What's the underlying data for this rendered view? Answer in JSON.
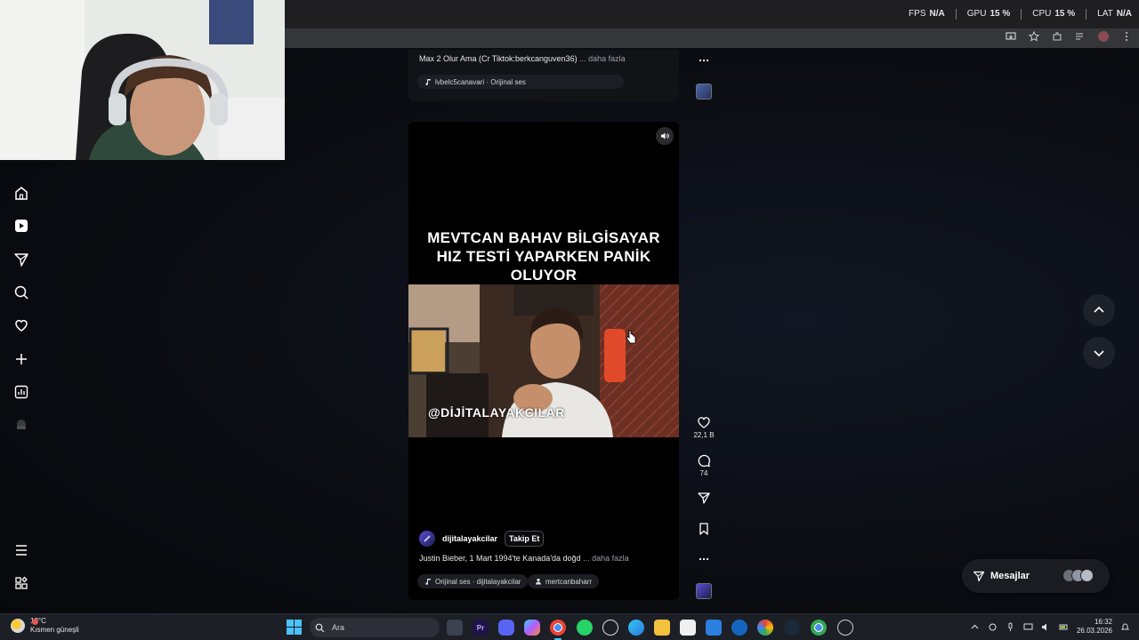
{
  "overlay": {
    "fps_label": "FPS",
    "fps_value": "N/A",
    "gpu_label": "GPU",
    "gpu_value": "15 %",
    "cpu_label": "CPU",
    "cpu_value": "15 %",
    "lat_label": "LAT",
    "lat_value": "N/A"
  },
  "browser": {
    "toolbar_icons": [
      "install-icon",
      "star-icon",
      "extensions-icon",
      "media-icon",
      "profile-icon",
      "menu-icon"
    ]
  },
  "left_nav": {
    "items": [
      {
        "name": "home-icon"
      },
      {
        "name": "reels-icon"
      },
      {
        "name": "send-icon"
      },
      {
        "name": "search-icon"
      },
      {
        "name": "heart-icon"
      },
      {
        "name": "plus-icon"
      },
      {
        "name": "dashboard-icon"
      },
      {
        "name": "avatar-icon"
      },
      {
        "name": "menu-icon"
      },
      {
        "name": "apps-icon"
      }
    ]
  },
  "previous_post": {
    "caption": "Max 2 Olur Ama (Cr Tiktok:berkcanguven36)",
    "more": "... daha fazla",
    "audio": "lvbelc5canavari · Orijinal ses"
  },
  "post": {
    "headline_lines": [
      "MEVTCAN BAHAV BİLGİSAYAR",
      "HIZ TESTİ YAPARKEN PANİK",
      "OLUYOR"
    ],
    "watermark": "@DİJİTALAYAKCILAR",
    "author": "dijitalayakcilar",
    "follow_label": "Takip Et",
    "caption": "Justin Bieber, 1 Mart 1994'te Kanada'da doğd",
    "more": "... daha fazla",
    "audio": "Orijinal ses · dijitalayakcilar",
    "tagged_user": "mertcanbaharr",
    "likes": "22,1 B",
    "comments": "74"
  },
  "messages": {
    "label": "Mesajlar"
  },
  "taskbar": {
    "temperature": "13°C",
    "weather": "Kısmen güneşli",
    "search_placeholder": "Ara",
    "time": "16:32",
    "date": "26.03.2026",
    "apps": [
      "file-explorer",
      "premiere-pro",
      "discord",
      "copilot",
      "chrome",
      "whatsapp",
      "chatgpt",
      "edge",
      "folder",
      "store",
      "mail",
      "app-a",
      "app-b",
      "steam",
      "chrome-alt",
      "app-c"
    ]
  },
  "colors": {
    "background": "#0b0d12",
    "accent": "#4cc2ff",
    "panel": "#1a1c22"
  }
}
